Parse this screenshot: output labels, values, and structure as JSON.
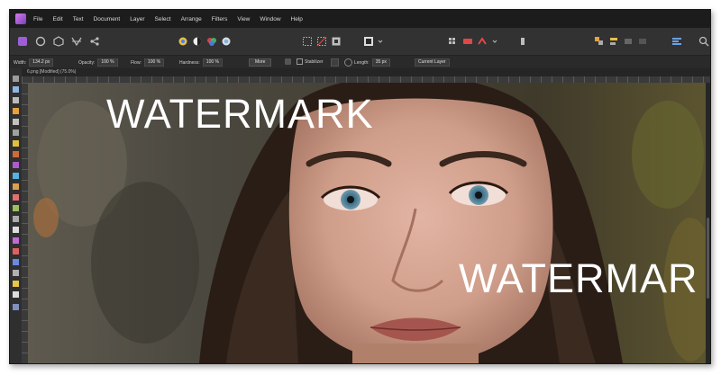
{
  "menu": [
    "File",
    "Edit",
    "Text",
    "Document",
    "Layer",
    "Select",
    "Arrange",
    "Filters",
    "View",
    "Window",
    "Help"
  ],
  "context_toolbar": {
    "width_label": "Width:",
    "width_value": "134.2 px",
    "opacity_label": "Opacity:",
    "opacity_value": "100 %",
    "flow_label": "Flow:",
    "flow_value": "100 %",
    "hardness_label": "Hardness:",
    "hardness_value": "100 %",
    "more_button": "More",
    "stabilizer_label": "Stabilizer",
    "length_label": "Length:",
    "length_value": "35 px",
    "layer_select": "Current Layer"
  },
  "document_tab": "6.png [Modified] (75.0%)",
  "watermarks": [
    "WATERMARK",
    "WATERMAR"
  ]
}
